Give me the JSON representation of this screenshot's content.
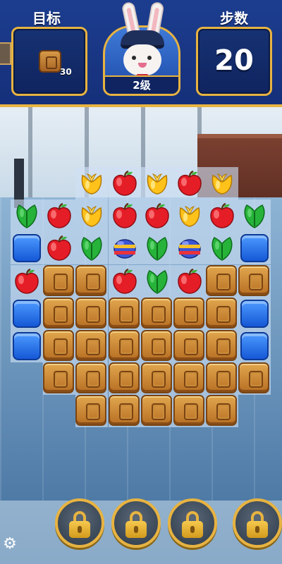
{
  "header": {
    "goal_label": "目标",
    "moves_label": "步数",
    "goal": {
      "icon": "crate-icon",
      "count": "30"
    },
    "moves": "20",
    "level": "2级",
    "avatar": "bunny-pilot-avatar"
  },
  "board": {
    "cols": 8,
    "rows": 8,
    "cells": [
      ". . t a t a t .",
      "l a t a a t a l",
      "j a l e l e l j",
      "a c c a l a c c",
      "j c c c c c c j",
      "j c c c c c c j",
      ". c c c c c c c",
      ". . c c c c c ."
    ],
    "legend": {
      "t": "yellow-tulip",
      "a": "red-apple",
      "l": "green-leaf",
      "e": "striped-egg",
      "c": "wooden-crate",
      "j": "blue-jelly"
    }
  },
  "boosters": [
    {
      "name": "locked-booster-1",
      "icon": "padlock-icon"
    },
    {
      "name": "locked-booster-2",
      "icon": "padlock-icon"
    },
    {
      "name": "locked-booster-3",
      "icon": "padlock-icon"
    },
    {
      "name": "locked-booster-4",
      "icon": "padlock-icon"
    }
  ],
  "settings_icon": "gear-icon",
  "colors": {
    "header": "#1c3d8f",
    "gold": "#e7b341",
    "crate": "#c07c2e",
    "jelly": "#2a6ff0"
  }
}
